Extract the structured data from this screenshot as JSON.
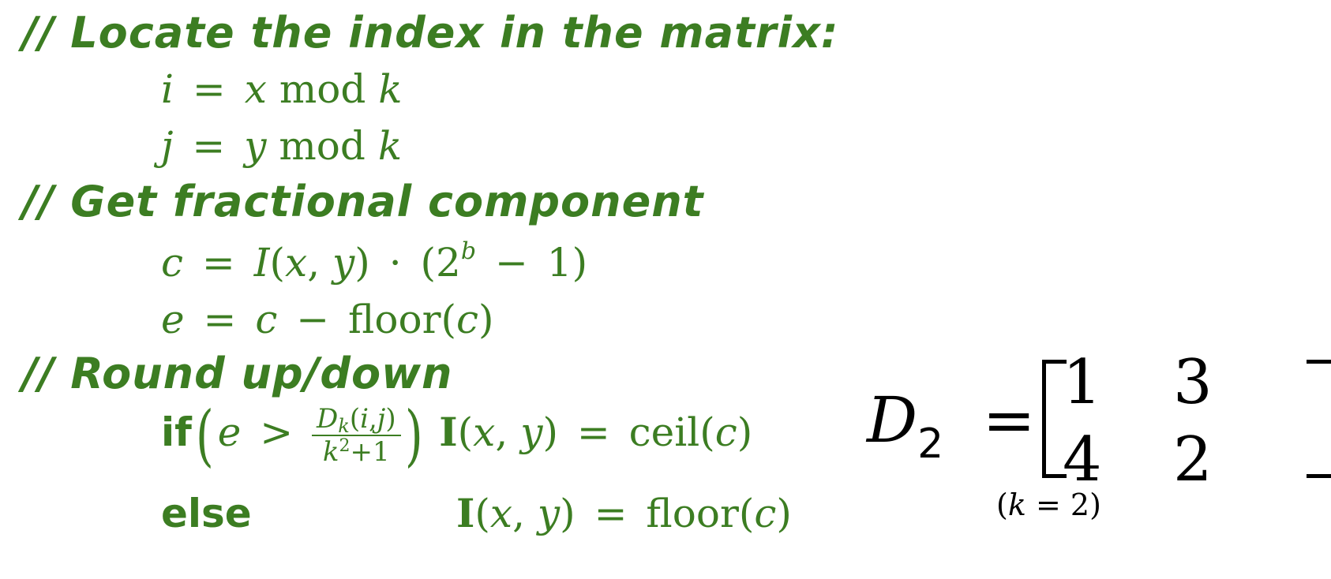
{
  "comments": {
    "locate": "// Locate the index in the matrix:",
    "fractional": "// Get fractional component",
    "round": "// Round up/down"
  },
  "index_eqs": {
    "i_lhs": "i",
    "j_lhs": "j",
    "eq": "=",
    "x": "x",
    "y": "y",
    "mod": "mod",
    "k": "k"
  },
  "frac_eqs": {
    "c": "c",
    "e": "e",
    "eq": "=",
    "I": "I",
    "open": "(",
    "close": ")",
    "comma": ",",
    "x": "x",
    "y": "y",
    "dot": "·",
    "two": "2",
    "b": "b",
    "minus": "−",
    "one": "1",
    "floor": "floor"
  },
  "round_eqs": {
    "if": "if",
    "else": "else",
    "gt": ">",
    "D": "D",
    "k": "k",
    "i": "i",
    "j": "j",
    "plus1": "+1",
    "sq": "2",
    "I": "I",
    "ceil": "ceil",
    "floor": "floor"
  },
  "matrix": {
    "name": "D",
    "subscript": "2",
    "eq": "=",
    "cells": [
      "1",
      "3",
      "4",
      "2"
    ],
    "label_open": "(",
    "label_k": "k",
    "label_eq": "= 2",
    "label_close": ")"
  }
}
